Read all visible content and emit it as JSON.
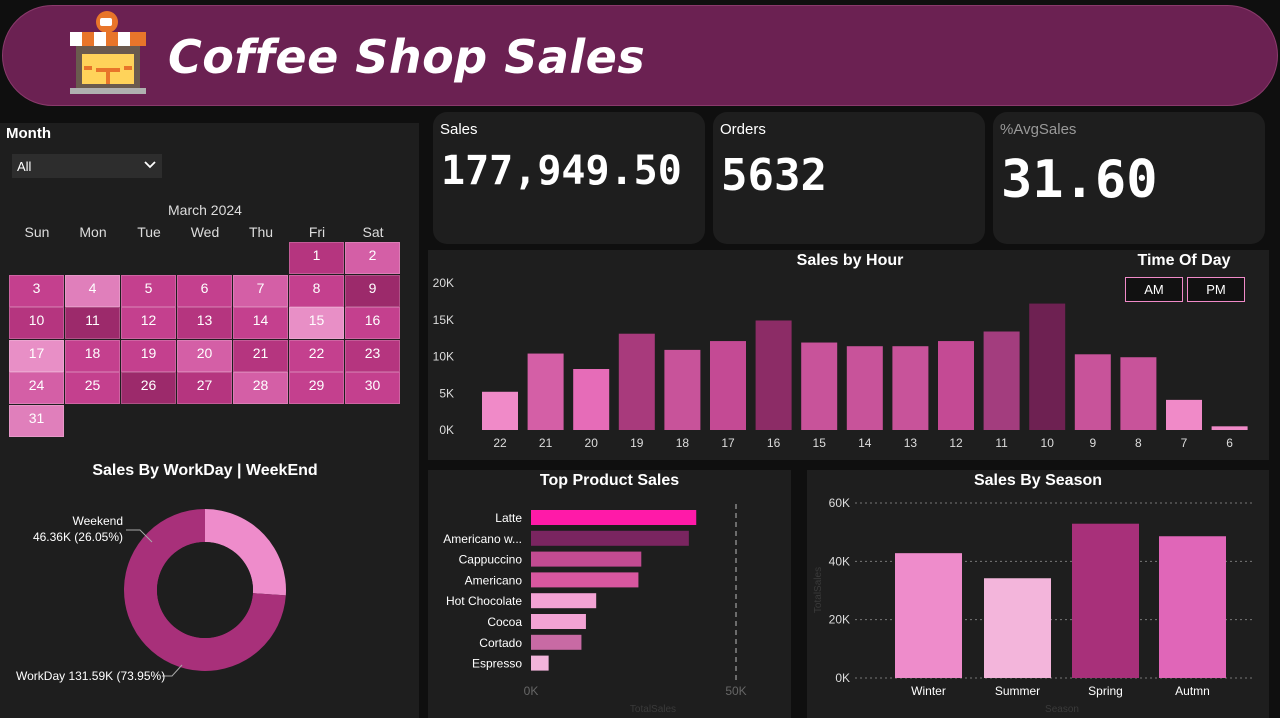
{
  "header": {
    "title": "Coffee Shop Sales",
    "icon": "coffee-shop-icon"
  },
  "kpis": {
    "sales": {
      "label": "Sales",
      "value": "177,949.50"
    },
    "orders": {
      "label": "Orders",
      "value": "5632"
    },
    "avg_sales": {
      "label": "%AvgSales",
      "value": "31.60"
    }
  },
  "month_slicer": {
    "title": "Month",
    "selected": "All"
  },
  "calendar": {
    "month_label": "March 2024",
    "day_headers": [
      "Sun",
      "Mon",
      "Tue",
      "Wed",
      "Thu",
      "Fri",
      "Sat"
    ],
    "start_weekday": 5,
    "days": [
      "1",
      "2",
      "3",
      "4",
      "5",
      "6",
      "7",
      "8",
      "9",
      "10",
      "11",
      "12",
      "13",
      "14",
      "15",
      "16",
      "17",
      "18",
      "19",
      "20",
      "21",
      "22",
      "23",
      "24",
      "25",
      "26",
      "27",
      "28",
      "29",
      "30",
      "31"
    ],
    "colors": [
      "#b5357f",
      "#d45fa6",
      "#c4408e",
      "#e07fbb",
      "#c4408e",
      "#c4408e",
      "#d45fa6",
      "#c4408e",
      "#9c2a6b",
      "#b5357f",
      "#9c2a6b",
      "#c4408e",
      "#b5357f",
      "#c4408e",
      "#e88fc6",
      "#c4408e",
      "#e88fc6",
      "#c4408e",
      "#c4408e",
      "#d45fa6",
      "#b5357f",
      "#c4408e",
      "#b5357f",
      "#d45fa6",
      "#c4408e",
      "#9c2a6b",
      "#b5357f",
      "#d45fa6",
      "#c4408e",
      "#c4408e",
      "#e07fbb"
    ]
  },
  "time_of_day": {
    "title": "Time Of Day",
    "options": [
      "AM",
      "PM"
    ]
  },
  "charts": {
    "workday_title": "Sales By WorkDay | WeekEnd",
    "hour_title": "Sales by Hour",
    "product_title": "Top Product Sales",
    "season_title": "Sales By Season"
  },
  "chart_data": [
    {
      "id": "sales_by_hour",
      "type": "bar",
      "title": "Sales by Hour",
      "categories": [
        "22",
        "21",
        "20",
        "19",
        "18",
        "17",
        "16",
        "15",
        "14",
        "13",
        "12",
        "11",
        "10",
        "9",
        "8",
        "7",
        "6"
      ],
      "values": [
        5200,
        10400,
        8300,
        13100,
        10900,
        12100,
        14900,
        11900,
        11400,
        11400,
        12100,
        13400,
        17200,
        10300,
        9900,
        4100,
        500
      ],
      "colors": [
        "#f08ac8",
        "#d45fa6",
        "#e66cb8",
        "#a83a7c",
        "#c8539a",
        "#c44a94",
        "#8c2c66",
        "#c8539a",
        "#c8539a",
        "#c8539a",
        "#c44a94",
        "#a33d7e",
        "#6e2152",
        "#c8539a",
        "#c8539a",
        "#f08ac8",
        "#f08ac8"
      ],
      "ylim": [
        0,
        20000
      ],
      "yticks": [
        "0K",
        "5K",
        "10K",
        "15K",
        "20K"
      ],
      "ytick_values": [
        0,
        5000,
        10000,
        15000,
        20000
      ]
    },
    {
      "id": "sales_by_workday",
      "type": "pie",
      "title": "Sales By WorkDay | WeekEnd",
      "slices": [
        {
          "name": "Weekend",
          "value": 46.36,
          "label_value": "46.36K (26.05%)",
          "color": "#ee8ccb"
        },
        {
          "name": "WorkDay",
          "value": 131.59,
          "label_value": "131.59K (73.95%)",
          "color": "#a8307a"
        }
      ]
    },
    {
      "id": "top_product_sales",
      "type": "bar",
      "orientation": "horizontal",
      "title": "Top Product Sales",
      "categories": [
        "Latte",
        "Americano w...",
        "Cappuccino",
        "Americano",
        "Hot Chocolate",
        "Cocoa",
        "Cortado",
        "Espresso"
      ],
      "values": [
        40300,
        38500,
        26900,
        26200,
        15900,
        13400,
        12300,
        4300
      ],
      "colors": [
        "#ff1aa8",
        "#7a2560",
        "#c24b91",
        "#d8579f",
        "#f3a3d4",
        "#f3a3d4",
        "#c86aa4",
        "#f3b5db"
      ],
      "xlim": [
        0,
        50000
      ],
      "xticks": [
        "0K",
        "50K"
      ],
      "xtick_values": [
        0,
        50000
      ],
      "xlabel": "TotalSales"
    },
    {
      "id": "sales_by_season",
      "type": "bar",
      "title": "Sales By Season",
      "categories": [
        "Winter",
        "Summer",
        "Spring",
        "Autmn"
      ],
      "values": [
        42800,
        34200,
        52900,
        48600
      ],
      "colors": [
        "#ee8ccb",
        "#f3b5db",
        "#a8307a",
        "#e066b8"
      ],
      "ylim": [
        0,
        60000
      ],
      "yticks": [
        "0K",
        "20K",
        "40K",
        "60K"
      ],
      "ytick_values": [
        0,
        20000,
        40000,
        60000
      ],
      "xlabel": "Season",
      "ylabel": "TotalSales"
    }
  ]
}
